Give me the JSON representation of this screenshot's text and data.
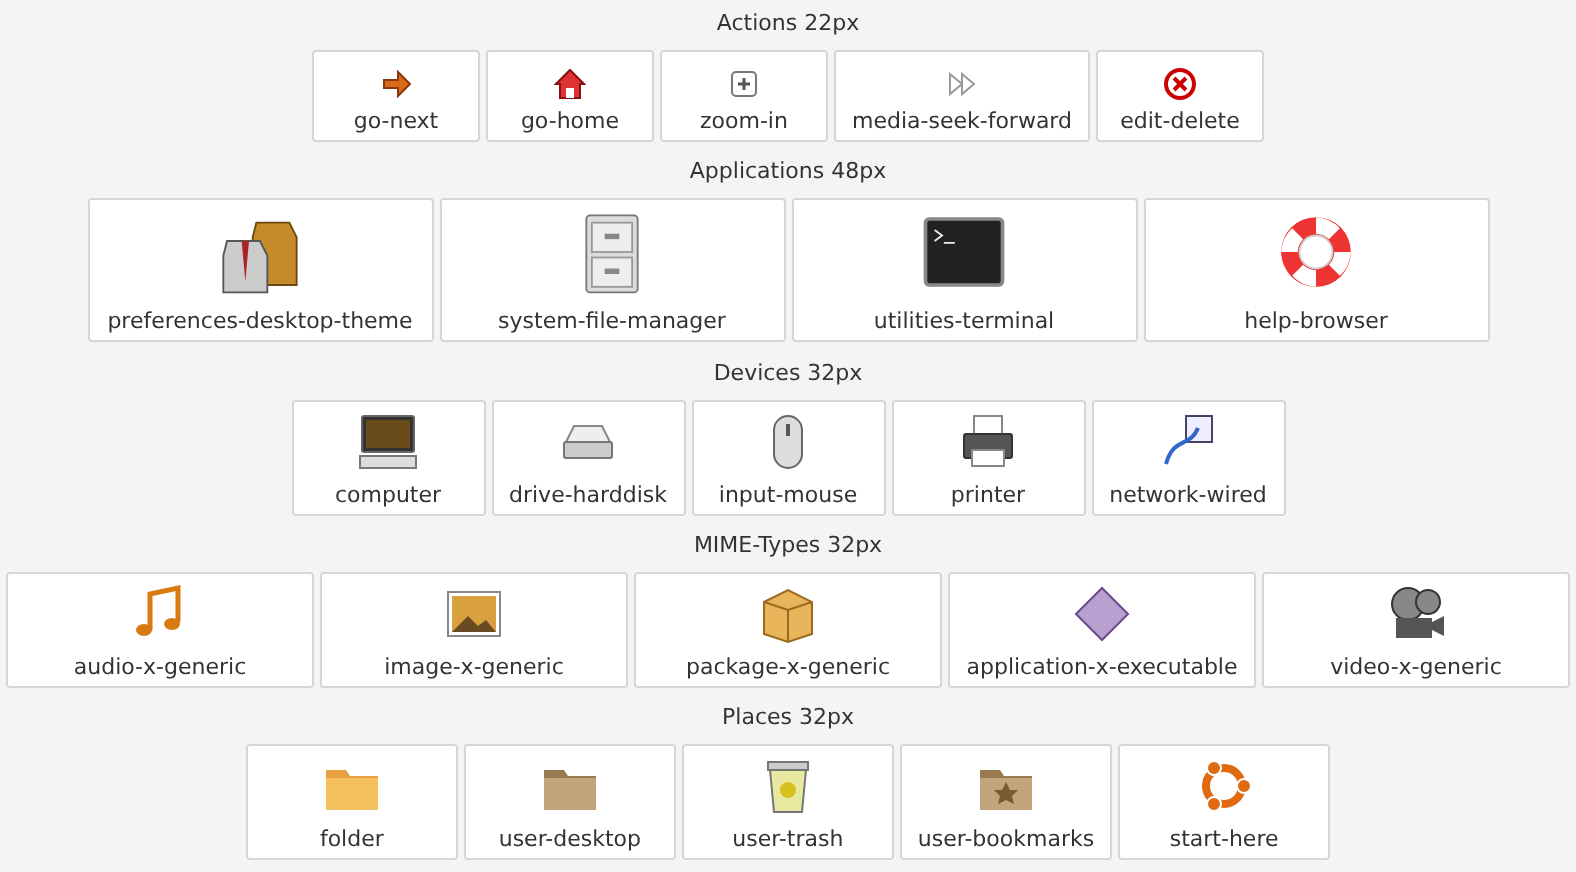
{
  "sections": [
    {
      "title": "Actions 22px",
      "items": [
        {
          "label": "go-next"
        },
        {
          "label": "go-home"
        },
        {
          "label": "zoom-in"
        },
        {
          "label": "media-seek-forward"
        },
        {
          "label": "edit-delete"
        }
      ]
    },
    {
      "title": "Applications 48px",
      "items": [
        {
          "label": "preferences-desktop-theme"
        },
        {
          "label": "system-file-manager"
        },
        {
          "label": "utilities-terminal"
        },
        {
          "label": "help-browser"
        }
      ]
    },
    {
      "title": "Devices 32px",
      "items": [
        {
          "label": "computer"
        },
        {
          "label": "drive-harddisk"
        },
        {
          "label": "input-mouse"
        },
        {
          "label": "printer"
        },
        {
          "label": "network-wired"
        }
      ]
    },
    {
      "title": "MIME-Types 32px",
      "items": [
        {
          "label": "audio-x-generic"
        },
        {
          "label": "image-x-generic"
        },
        {
          "label": "package-x-generic"
        },
        {
          "label": "application-x-executable"
        },
        {
          "label": "video-x-generic"
        }
      ]
    },
    {
      "title": "Places 32px",
      "items": [
        {
          "label": "folder"
        },
        {
          "label": "user-desktop"
        },
        {
          "label": "user-trash"
        },
        {
          "label": "user-bookmarks"
        },
        {
          "label": "start-here"
        }
      ]
    }
  ]
}
